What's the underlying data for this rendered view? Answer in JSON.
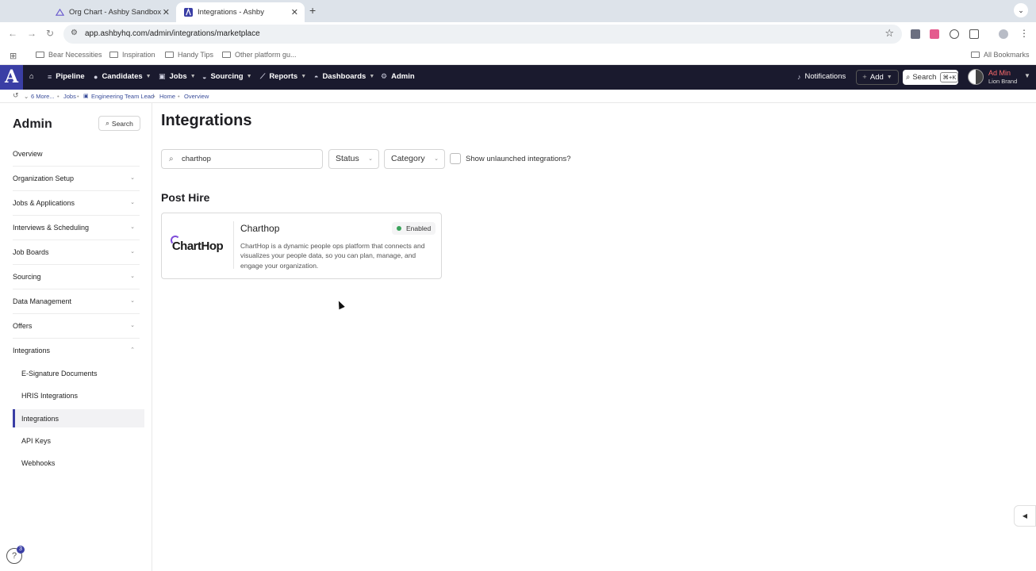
{
  "browser": {
    "tabs": [
      {
        "title": "Org Chart - Ashby Sandbox",
        "icon": "orgchart-favicon",
        "active": false
      },
      {
        "title": "Integrations - Ashby",
        "icon": "ashby-favicon",
        "active": true
      }
    ],
    "url": "app.ashbyhq.com/admin/integrations/marketplace",
    "bookmarks": [
      "Bear Necessities",
      "Inspiration",
      "Handy Tips",
      "Other platform gu..."
    ],
    "all_bookmarks": "All Bookmarks"
  },
  "appnav": {
    "logo": "A",
    "items": [
      "Pipeline",
      "Candidates",
      "Jobs",
      "Sourcing",
      "Reports",
      "Dashboards",
      "Admin"
    ],
    "notifications": "Notifications",
    "add": "Add",
    "search": "Search",
    "search_shortcut": "⌘+K",
    "user_name": "Ad Min",
    "user_org": "Lion Brand"
  },
  "breadcrumb": [
    "6 More...",
    "Jobs",
    "Engineering Team Lead",
    "Home",
    "Overview"
  ],
  "sidebar": {
    "title": "Admin",
    "search": "Search",
    "items": [
      "Overview",
      "Organization Setup",
      "Jobs & Applications",
      "Interviews & Scheduling",
      "Job Boards",
      "Sourcing",
      "Data Management",
      "Offers",
      "Integrations"
    ],
    "subitems": [
      "E-Signature Documents",
      "HRIS Integrations",
      "Integrations",
      "API Keys",
      "Webhooks"
    ],
    "active_subitem": "Integrations",
    "help_badge": "3"
  },
  "main": {
    "title": "Integrations",
    "search_value": "charthop",
    "status_select": "Status",
    "category_select": "Category",
    "show_unlaunched": "Show unlaunched integrations?",
    "section": "Post Hire",
    "card": {
      "logo_text": "ChartHop",
      "name": "Charthop",
      "status": "Enabled",
      "description": "ChartHop is a dynamic people ops platform that connects and visualizes your people data, so you can plan, manage, and engage your organization."
    }
  },
  "colors": {
    "brand": "#3a3ea5",
    "navbar": "#1a1a2e",
    "enabled": "#3aa35b"
  }
}
